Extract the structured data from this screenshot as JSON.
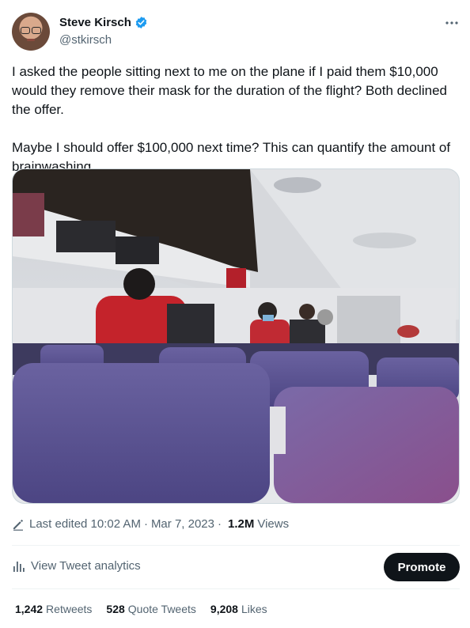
{
  "author": {
    "name": "Steve Kirsch",
    "handle": "@stkirsch",
    "verified": true,
    "verified_color": "#1d9bf0"
  },
  "tweet": {
    "paragraph_1": "I asked the people sitting next to me on the plane if I paid them $10,000 would they remove their mask for the duration of the flight? Both declined the offer.",
    "paragraph_2": "Maybe I should offer $100,000 next time? This can quantify the amount of brainwashing."
  },
  "media": {
    "seat_color": "#5c5490",
    "ceiling_color": "#d8dade"
  },
  "meta": {
    "edited_label": "Last edited 10:02 AM",
    "separator": "·",
    "date": "Mar 7, 2023",
    "views_count": "1.2M",
    "views_label": "Views"
  },
  "actions": {
    "analytics_label": "View Tweet analytics",
    "promote_label": "Promote"
  },
  "stats": {
    "retweets_count": "1,242",
    "retweets_label": "Retweets",
    "quotes_count": "528",
    "quotes_label": "Quote Tweets",
    "likes_count": "9,208",
    "likes_label": "Likes"
  },
  "icons": {
    "more": "more-horizontal-icon",
    "verified": "verified-badge-icon",
    "edit": "pencil-icon",
    "analytics": "bar-chart-icon"
  }
}
